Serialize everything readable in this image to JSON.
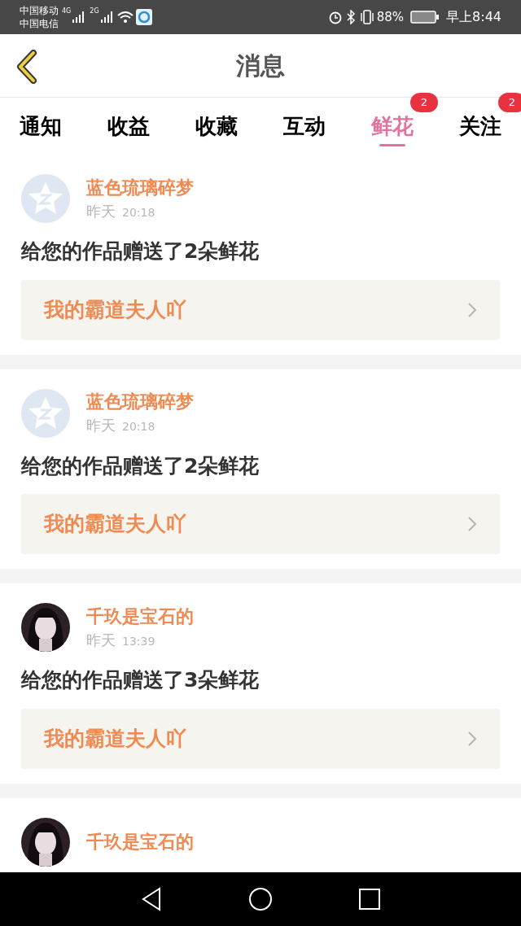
{
  "status_bar": {
    "carriers": [
      "中国移动",
      "中国电信"
    ],
    "network_1": "4G",
    "network_2": "2G",
    "battery": "88%",
    "time": "早上8:44"
  },
  "header": {
    "title": "消息"
  },
  "tabs": [
    {
      "label": "通知",
      "selected": false
    },
    {
      "label": "收益",
      "selected": false
    },
    {
      "label": "收藏",
      "selected": false
    },
    {
      "label": "互动",
      "selected": false
    },
    {
      "label": "鲜花",
      "selected": true,
      "badge": "2"
    },
    {
      "label": "关注",
      "selected": false,
      "badge": "2"
    }
  ],
  "messages": [
    {
      "avatar": {
        "kind": "default"
      },
      "name": "蓝色琉璃碎梦",
      "day": "昨天",
      "time": "20:18",
      "text": "给您的作品赠送了2朵鲜花",
      "work": "我的霸道夫人吖"
    },
    {
      "avatar": {
        "kind": "default"
      },
      "name": "蓝色琉璃碎梦",
      "day": "昨天",
      "time": "20:18",
      "text": "给您的作品赠送了2朵鲜花",
      "work": "我的霸道夫人吖"
    },
    {
      "name": "千玖是宝石的",
      "day": "昨天",
      "time": "13:39",
      "text": "给您的作品赠送了3朵鲜花",
      "work": "我的霸道夫人吖"
    },
    {
      "name": "千玖是宝石的"
    }
  ]
}
